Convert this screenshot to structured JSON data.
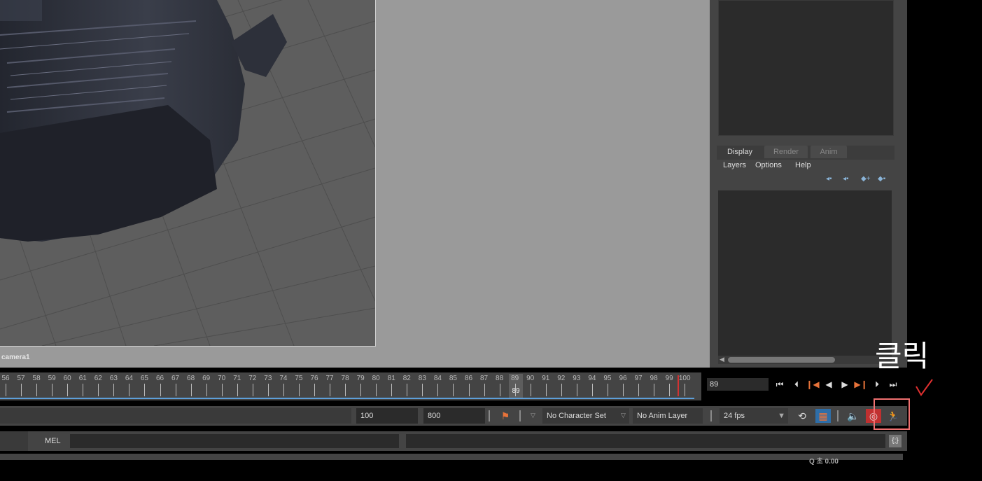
{
  "viewport": {
    "camera_label": "camera1"
  },
  "layer_editor": {
    "tabs": [
      "Display",
      "Render",
      "Anim"
    ],
    "active_tab": "Display",
    "menu": [
      "Layers",
      "Options",
      "Help"
    ],
    "icons": [
      "move-layer-up-icon",
      "move-layer-down-icon",
      "new-layer-icon",
      "new-layer-from-selection-icon"
    ]
  },
  "time_slider": {
    "frame_numbers": [
      "56",
      "57",
      "58",
      "59",
      "60",
      "61",
      "62",
      "63",
      "64",
      "65",
      "66",
      "67",
      "68",
      "69",
      "70",
      "71",
      "72",
      "73",
      "74",
      "75",
      "76",
      "77",
      "78",
      "79",
      "80",
      "81",
      "82",
      "83",
      "84",
      "85",
      "86",
      "87",
      "88",
      "89",
      "90",
      "91",
      "92",
      "93",
      "94",
      "95",
      "96",
      "97",
      "98",
      "99",
      "100"
    ],
    "current_frame": "89",
    "current_frame_field": "89",
    "playback_icons": [
      "go-to-start-icon",
      "step-back-icon",
      "step-back-key-icon",
      "play-backwards-icon",
      "play-forwards-icon",
      "step-forward-key-icon",
      "step-forward-icon",
      "go-to-end-icon"
    ]
  },
  "range_slider": {
    "end_time": "100",
    "animation_end": "800",
    "character_set": "No Character Set",
    "anim_layer": "No Anim Layer",
    "fps": "24 fps"
  },
  "command_line": {
    "language": "MEL"
  },
  "help_line": {
    "text": "Q 초 0.00"
  },
  "annotation": {
    "text": "클릭",
    "check_mark": "✓",
    "colors": {
      "highlight": "#f07070",
      "check": "#e03030"
    }
  },
  "colors": {
    "blue_line": "#5d9fd9",
    "end_marker": "#d23232",
    "key_icon": "#e8733a"
  }
}
